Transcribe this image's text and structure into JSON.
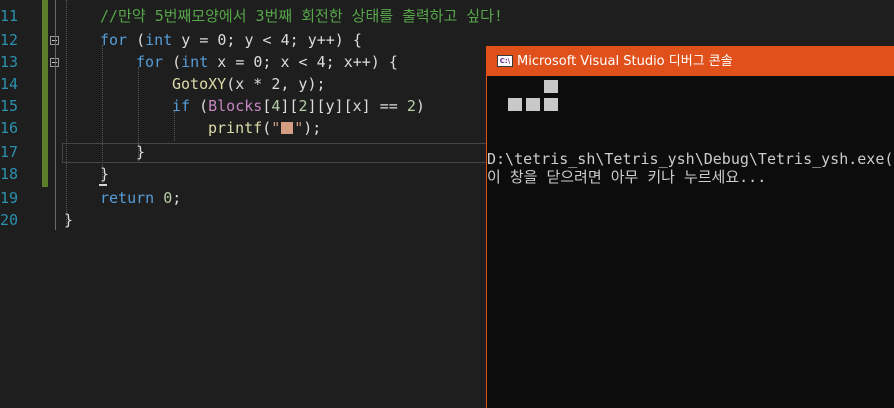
{
  "editor": {
    "lines": [
      {
        "num": "11",
        "comment": "//만약 5번째모양에서 3번째 회전한 상태를 출력하고 싶다!"
      },
      {
        "num": "12",
        "kw_for": "for",
        "paren_open": " (",
        "kw_int": "int",
        "rest": " y = 0; y < 4; y++) {"
      },
      {
        "num": "13",
        "kw_for": "for",
        "paren_open": " (",
        "kw_int": "int",
        "rest": " x = 0; x < 4; x++) {"
      },
      {
        "num": "14",
        "fn": "GotoXY",
        "rest": "(x * 2, y);"
      },
      {
        "num": "15",
        "kw_if": "if",
        "paren_open": " (",
        "macro": "Blocks",
        "idx_a": "[",
        "n4": "4",
        "idx_b": "][",
        "n2": "2",
        "idx_c": "][y][x] == ",
        "n2b": "2",
        "close": ")"
      },
      {
        "num": "16",
        "fn": "printf",
        "open": "(",
        "q1": "\"",
        "q2": "\"",
        "close": ");"
      },
      {
        "num": "17",
        "brace": "}"
      },
      {
        "num": "18",
        "brace": "}"
      },
      {
        "num": "19",
        "kw_return": "return",
        "space": " ",
        "n0": "0",
        "semi": ";"
      },
      {
        "num": "20",
        "brace": "}"
      }
    ]
  },
  "console": {
    "title": "Microsoft Visual Studio 디버그 콘솔",
    "icon_text": "C:\\",
    "output_lines": [
      "D:\\tetris_sh\\Tetris_ysh\\Debug\\Tetris_ysh.exe(",
      "이 창을 닫으려면 아무 키나 누르세요..."
    ]
  },
  "colors": {
    "accent": "#e0501a",
    "keyword": "#569cd6",
    "comment": "#57a64a",
    "function": "#dcdcaa",
    "macro": "#c586c0",
    "number": "#b5cea8",
    "string": "#d69d85"
  }
}
